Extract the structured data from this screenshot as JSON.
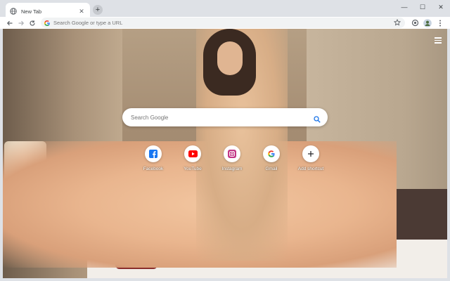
{
  "tab": {
    "title": "New Tab",
    "close": "✕",
    "favicon": "globe-icon"
  },
  "new_tab_button": "+",
  "window_controls": {
    "minimize": "—",
    "maximize": "☐",
    "close": "✕"
  },
  "toolbar": {
    "back": "back-icon",
    "forward": "forward-icon",
    "reload": "reload-icon",
    "omnibox_placeholder": "Search Google or type a URL",
    "bookmark": "star-icon",
    "extension": "extension-icon",
    "profile": "avatar",
    "menu": "kebab-menu-icon"
  },
  "newtab": {
    "search_placeholder": "Search Google",
    "menu_icon": "hamburger-icon",
    "shortcuts": [
      {
        "label": "Facebook",
        "icon": "facebook-icon",
        "color": "#1877f2"
      },
      {
        "label": "YouTube",
        "icon": "youtube-icon",
        "color": "#ff0000"
      },
      {
        "label": "Instagram",
        "icon": "instagram-icon",
        "color": "#c13584"
      },
      {
        "label": "Gmail",
        "icon": "google-icon",
        "color": "#4285f4"
      },
      {
        "label": "Add shortcut",
        "icon": "plus-icon",
        "color": "#202124"
      }
    ]
  }
}
